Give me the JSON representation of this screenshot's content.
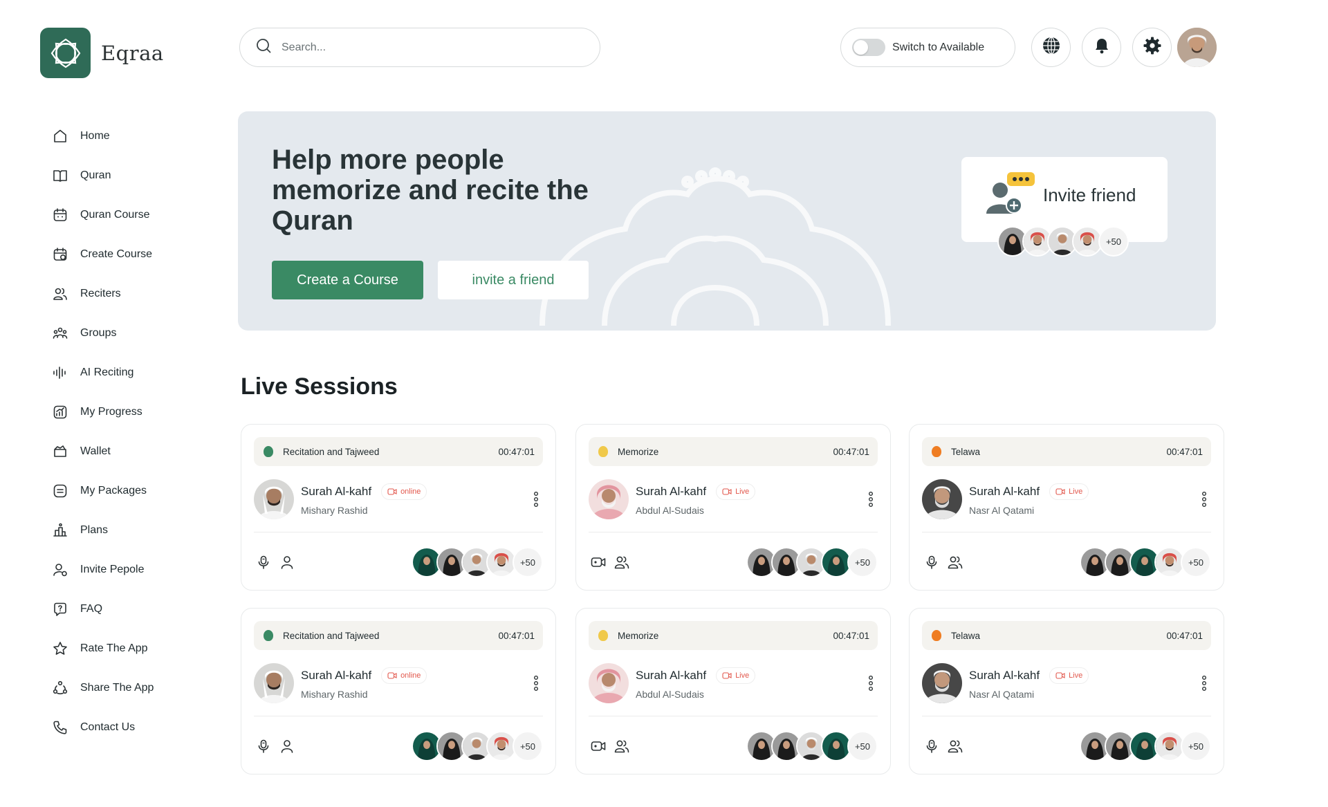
{
  "app": {
    "name": "Eqraa"
  },
  "search": {
    "placeholder": "Search..."
  },
  "availability": {
    "label": "Switch to Available",
    "enabled": false
  },
  "nav": [
    {
      "label": "Home",
      "icon": "home-icon"
    },
    {
      "label": "Quran",
      "icon": "book-icon"
    },
    {
      "label": "Quran Course",
      "icon": "calendar-icon"
    },
    {
      "label": "Create Course",
      "icon": "calendar-add-icon"
    },
    {
      "label": "Reciters",
      "icon": "users-icon"
    },
    {
      "label": "Groups",
      "icon": "groups-icon"
    },
    {
      "label": "AI Reciting",
      "icon": "waveform-icon"
    },
    {
      "label": "My Progress",
      "icon": "progress-chart-icon"
    },
    {
      "label": "Wallet",
      "icon": "wallet-icon"
    },
    {
      "label": "My Packages",
      "icon": "package-icon"
    },
    {
      "label": "Plans",
      "icon": "plans-icon"
    },
    {
      "label": "Invite Pepole",
      "icon": "invite-user-icon"
    },
    {
      "label": "FAQ",
      "icon": "question-icon"
    },
    {
      "label": "Rate The App",
      "icon": "star-icon"
    },
    {
      "label": "Share The App",
      "icon": "share-icon"
    },
    {
      "label": "Contact Us",
      "icon": "phone-icon"
    }
  ],
  "banner": {
    "title": "Help more people memorize and recite the Quran",
    "primary_button": "Create a Course",
    "secondary_button": "invite a friend",
    "invite_card": {
      "label": "Invite friend",
      "count": "+50"
    }
  },
  "live_sessions": {
    "title": "Live Sessions",
    "cards": [
      {
        "category": "Recitation and Tajweed",
        "category_color": "#3a8a64",
        "time": "00:47:01",
        "surah": "Surah Al-kahf",
        "status": "online",
        "reciter": "Mishary Rashid",
        "mode": "audio",
        "people": "single",
        "count": "+50"
      },
      {
        "category": "Memorize",
        "category_color": "#f0c94a",
        "time": "00:47:01",
        "surah": "Surah Al-kahf",
        "status": "Live",
        "reciter": "Abdul Al-Sudais",
        "mode": "video",
        "people": "group",
        "count": "+50"
      },
      {
        "category": "Telawa",
        "category_color": "#ef7d22",
        "time": "00:47:01",
        "surah": "Surah Al-kahf",
        "status": "Live",
        "reciter": "Nasr Al Qatami",
        "mode": "audio",
        "people": "group",
        "count": "+50"
      },
      {
        "category": "Recitation and Tajweed",
        "category_color": "#3a8a64",
        "time": "00:47:01",
        "surah": "Surah Al-kahf",
        "status": "online",
        "reciter": "Mishary Rashid",
        "mode": "audio",
        "people": "single",
        "count": "+50"
      },
      {
        "category": "Memorize",
        "category_color": "#f0c94a",
        "time": "00:47:01",
        "surah": "Surah Al-kahf",
        "status": "Live",
        "reciter": "Abdul Al-Sudais",
        "mode": "video",
        "people": "group",
        "count": "+50"
      },
      {
        "category": "Telawa",
        "category_color": "#ef7d22",
        "time": "00:47:01",
        "surah": "Surah Al-kahf",
        "status": "Live",
        "reciter": "Nasr Al Qatami",
        "mode": "audio",
        "people": "group",
        "count": "+50"
      }
    ]
  },
  "colors": {
    "brand": "#2f6b57",
    "accent": "#3a8a64",
    "live": "#e2574c",
    "banner_bg": "#e4e9ee"
  }
}
